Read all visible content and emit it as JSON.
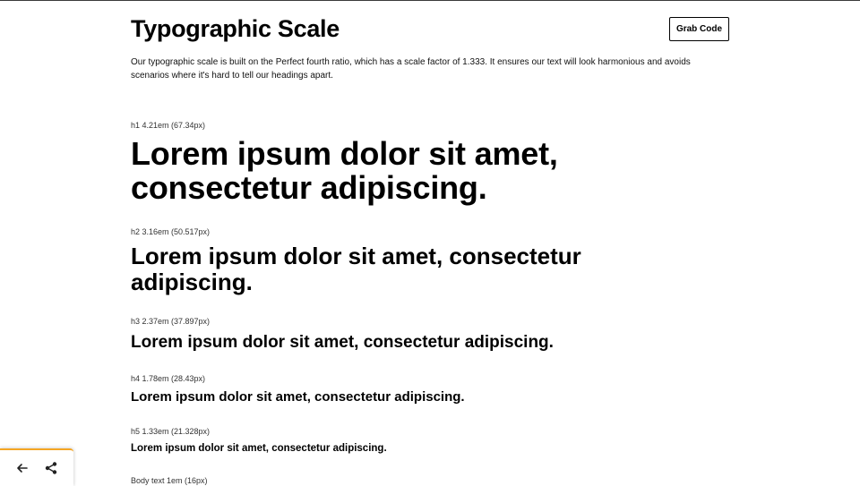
{
  "header": {
    "title": "Typographic Scale",
    "grab_code_label": "Grab Code"
  },
  "description": "Our typographic scale is built on the Perfect fourth ratio, which has a scale factor of 1.333. It ensures our text will look harmonious and avoids scenarios where it's hard to tell our headings apart.",
  "scale": {
    "h1": {
      "label": "h1 4.21em (67.34px)",
      "sample": "Lorem ipsum dolor sit amet, consectetur adipiscing."
    },
    "h2": {
      "label": "h2 3.16em (50.517px)",
      "sample": "Lorem ipsum dolor sit amet, consectetur adipiscing."
    },
    "h3": {
      "label": "h3 2.37em (37.897px)",
      "sample": "Lorem ipsum dolor sit amet, consectetur adipiscing."
    },
    "h4": {
      "label": "h4 1.78em (28.43px)",
      "sample": "Lorem ipsum dolor sit amet, consectetur adipiscing."
    },
    "h5": {
      "label": "h5 1.33em (21.328px)",
      "sample": "Lorem ipsum dolor sit amet, consectetur adipiscing."
    },
    "body": {
      "label": "Body text 1em (16px)"
    }
  },
  "bottom_bar": {
    "accent_color": "#f5a623",
    "icons": [
      "arrow-left-icon",
      "share-icon"
    ]
  }
}
